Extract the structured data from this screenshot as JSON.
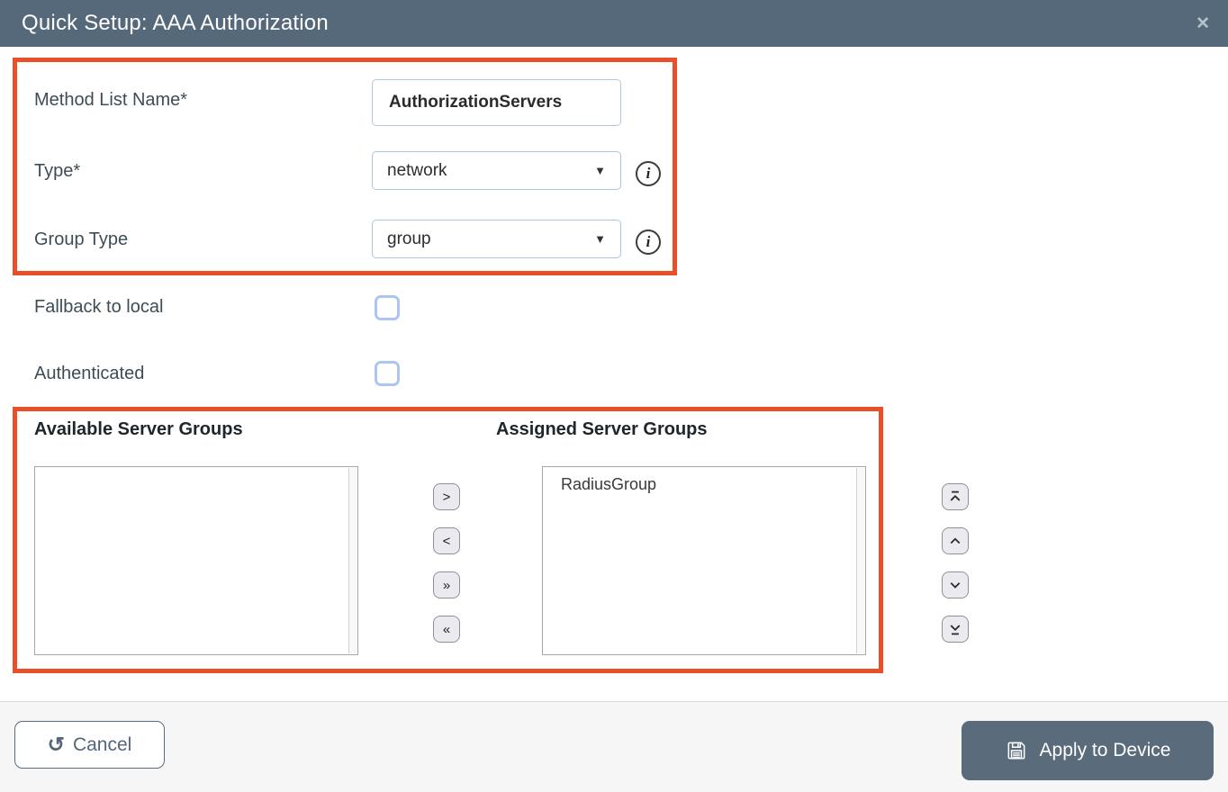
{
  "dialog": {
    "title": "Quick Setup: AAA Authorization"
  },
  "icons": {
    "close": "✕",
    "caret": "▼",
    "info": "i",
    "undo": "↺",
    "save": "floppy-disk",
    "transfer": {
      "move_right": ">",
      "move_left": "<",
      "move_all_right": "»",
      "move_all_left": "«"
    },
    "order": [
      "move-to-top",
      "move-up",
      "move-down",
      "move-to-bottom"
    ]
  },
  "form": {
    "method_list_name": {
      "label": "Method List Name*",
      "value": "AuthorizationServers"
    },
    "type": {
      "label": "Type*",
      "value": "network"
    },
    "group_type": {
      "label": "Group Type",
      "value": "group"
    },
    "fallback_to_local": {
      "label": "Fallback to local",
      "checked": false
    },
    "authenticated": {
      "label": "Authenticated",
      "checked": false
    }
  },
  "server_groups": {
    "available": {
      "label": "Available Server Groups",
      "items": []
    },
    "assigned": {
      "label": "Assigned Server Groups",
      "items": [
        "RadiusGroup"
      ]
    }
  },
  "footer": {
    "cancel": "Cancel",
    "apply": "Apply to Device"
  },
  "colors": {
    "header_bg": "#56697b",
    "highlight_border": "#e8502a",
    "checkbox_border": "#aec4f5",
    "field_border": "#a9c6de",
    "footer_bg": "#f6f6f7",
    "button_bg": "#5a6b7c"
  }
}
